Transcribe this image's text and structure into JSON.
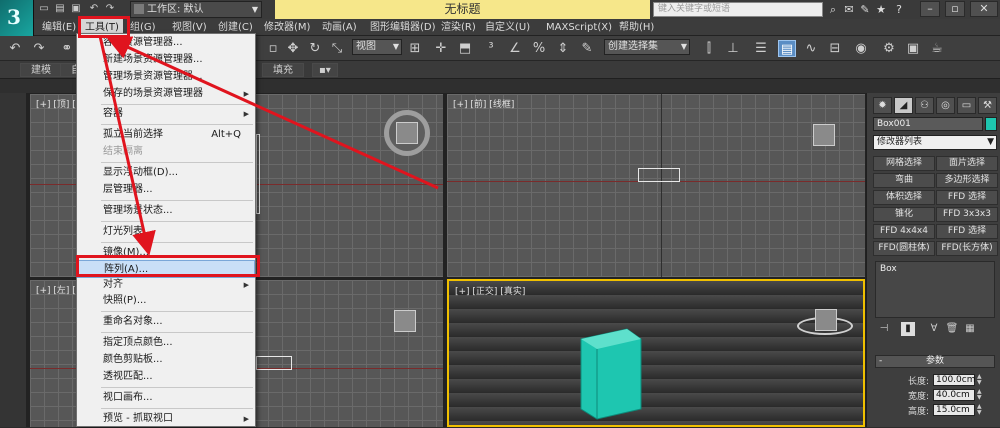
{
  "titlebar": {
    "workspace_label": "工作区: 默认",
    "doc_title": "无标题",
    "search_placeholder": "键入关键字或短语"
  },
  "menubar": {
    "items": [
      "编辑(E)",
      "工具(T)",
      "组(G)",
      "视图(V)",
      "创建(C)",
      "修改器(M)",
      "动画(A)",
      "图形编辑器(D)",
      "渲染(R)",
      "自定义(U)",
      "MAXScript(X)",
      "帮助(H)"
    ],
    "active_index": 1
  },
  "toolbar": {
    "view_select": "视图",
    "selection_set": "创建选择集"
  },
  "ribbon": {
    "tabs": [
      "建模",
      "自",
      "填充"
    ]
  },
  "viewports": {
    "top_left": "[+] [顶] [线",
    "top_right": "[+] [前] [线框]",
    "bottom_left": "[+] [左] [线",
    "bottom_right": "[+] [正交] [真实]"
  },
  "dropdown": {
    "items": [
      {
        "label": "容器资源管理器...",
        "disabled": false
      },
      {
        "label": "新建场景资源管理器...",
        "disabled": false
      },
      {
        "label": "管理场景资源管理器...",
        "disabled": false
      },
      {
        "label": "保存的场景资源管理器",
        "disabled": false,
        "submenu": true
      },
      {
        "label": "容器",
        "disabled": false,
        "submenu": true
      },
      {
        "label": "孤立当前选择",
        "disabled": false,
        "shortcut": "Alt+Q"
      },
      {
        "label": "结束隔离",
        "disabled": true
      },
      {
        "label": "显示浮动框(D)...",
        "disabled": false
      },
      {
        "label": "层管理器...",
        "disabled": false
      },
      {
        "label": "管理场景状态...",
        "disabled": false
      },
      {
        "label": "灯光列表...",
        "disabled": false
      },
      {
        "label": "镜像(M)...",
        "disabled": false
      },
      {
        "label": "阵列(A)...",
        "disabled": false,
        "highlight": true
      },
      {
        "label": "对齐",
        "disabled": false,
        "submenu": true
      },
      {
        "label": "快照(P)...",
        "disabled": false
      },
      {
        "label": "重命名对象...",
        "disabled": false
      },
      {
        "label": "指定顶点颜色...",
        "disabled": false
      },
      {
        "label": "颜色剪贴板...",
        "disabled": false
      },
      {
        "label": "透视匹配...",
        "disabled": false
      },
      {
        "label": "视口画布...",
        "disabled": false
      },
      {
        "label": "预览 - 抓取视口",
        "disabled": false,
        "submenu": true
      }
    ]
  },
  "command_panel": {
    "object_name": "Box001",
    "object_color": "#1ec6b0",
    "modifier_list": "修改器列表",
    "modifier_buttons": [
      "网格选择",
      "面片选择",
      "弯曲",
      "多边形选择",
      "体积选择",
      "FFD 选择",
      "锥化",
      "FFD 3x3x3",
      "FFD 4x4x4",
      "FFD 选择",
      "FFD(圆柱体)",
      "FFD(长方体)"
    ],
    "stack_item": "Box",
    "params_title": "参数",
    "params": [
      {
        "label": "长度:",
        "value": "100.0cm"
      },
      {
        "label": "宽度:",
        "value": "40.0cm"
      },
      {
        "label": "高度:",
        "value": "15.0cm"
      }
    ]
  },
  "colors": {
    "annotation_red": "#e0141e",
    "active_viewport_border": "#f0c000",
    "box_teal": "#1ec6b0",
    "highlight_blue": "#c9dff7"
  }
}
